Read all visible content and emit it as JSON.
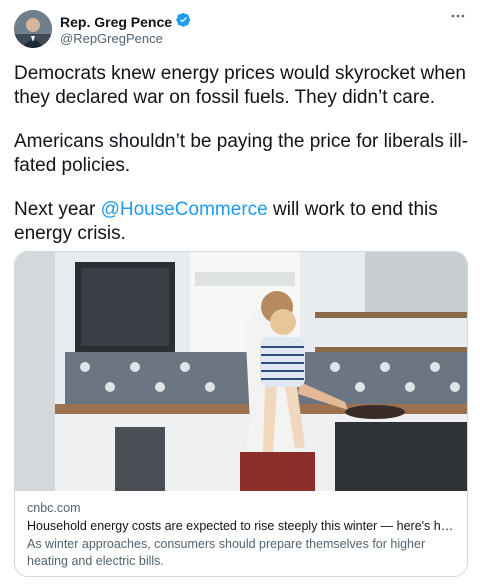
{
  "author": {
    "display_name": "Rep. Greg Pence",
    "handle": "@RepGregPence",
    "verified": true
  },
  "tweet": {
    "paragraph1": "Democrats knew energy prices would skyrocket when they declared war on fossil fuels. They didn’t care.",
    "paragraph2": "Americans shouldn’t be paying the price for liberals ill-fated policies.",
    "paragraph3_before": "Next year ",
    "mention": "@HouseCommerce",
    "paragraph3_after": " will work to end this energy crisis."
  },
  "card": {
    "domain": "cnbc.com",
    "title": "Household energy costs are expected to rise steeply this winter — here's how y...",
    "description": "As winter approaches, consumers should prepare themselves for higher heating and electric bills."
  },
  "colors": {
    "text": "#0f1419",
    "secondary": "#536471",
    "link": "#1d9bf0",
    "verified": "#1d9bf0",
    "border": "#cfd9de"
  },
  "icons": {
    "verified": "verified-badge-icon",
    "more": "more-options-icon"
  }
}
